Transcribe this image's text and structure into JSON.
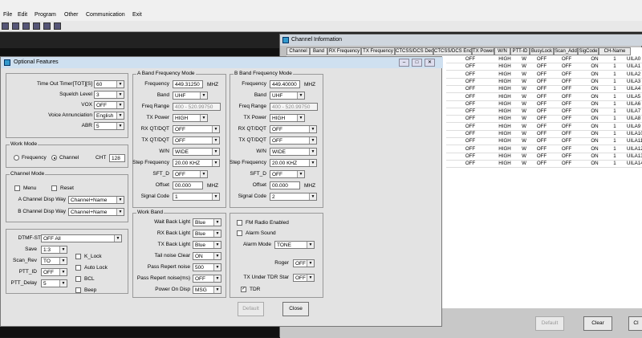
{
  "menubar": {
    "file": "File",
    "edit": "Edit",
    "program": "Program",
    "other": "Other",
    "communication": "Communication",
    "exit": "Exit"
  },
  "channel_window": {
    "title": "Channel Information",
    "headers": [
      "Channel",
      "Band",
      "RX Frequency",
      "TX Frequency",
      "CTCSS/DCS Dec",
      "CTCSS/DCS Enc",
      "TX Power",
      "W/N",
      "PTT-ID",
      "BusyLock",
      "Scan_Add",
      "SigCode",
      "CH-Name"
    ],
    "rows": [
      [
        "OFF",
        "HIGH",
        "W",
        "OFF",
        "OFF",
        "ON",
        "1",
        "UILA0"
      ],
      [
        "OFF",
        "HIGH",
        "W",
        "OFF",
        "OFF",
        "ON",
        "1",
        "UILA1"
      ],
      [
        "OFF",
        "HIGH",
        "W",
        "OFF",
        "OFF",
        "ON",
        "1",
        "UILA2"
      ],
      [
        "OFF",
        "HIGH",
        "W",
        "OFF",
        "OFF",
        "ON",
        "1",
        "UILA3"
      ],
      [
        "OFF",
        "HIGH",
        "W",
        "OFF",
        "OFF",
        "ON",
        "1",
        "UILA4"
      ],
      [
        "OFF",
        "HIGH",
        "W",
        "OFF",
        "OFF",
        "ON",
        "1",
        "UILA5"
      ],
      [
        "OFF",
        "HIGH",
        "W",
        "OFF",
        "OFF",
        "ON",
        "1",
        "UILA6"
      ],
      [
        "OFF",
        "HIGH",
        "W",
        "OFF",
        "OFF",
        "ON",
        "1",
        "UILA7"
      ],
      [
        "OFF",
        "HIGH",
        "W",
        "OFF",
        "OFF",
        "ON",
        "1",
        "UILA8"
      ],
      [
        "OFF",
        "HIGH",
        "W",
        "OFF",
        "OFF",
        "ON",
        "1",
        "UILA9"
      ],
      [
        "OFF",
        "HIGH",
        "W",
        "OFF",
        "OFF",
        "ON",
        "1",
        "UILA10"
      ],
      [
        "OFF",
        "HIGH",
        "W",
        "OFF",
        "OFF",
        "ON",
        "1",
        "UILA11"
      ],
      [
        "OFF",
        "HIGH",
        "W",
        "OFF",
        "OFF",
        "ON",
        "1",
        "UILA12"
      ],
      [
        "OFF",
        "HIGH",
        "W",
        "OFF",
        "OFF",
        "ON",
        "1",
        "UILA13"
      ],
      [
        "OFF",
        "HIGH",
        "W",
        "OFF",
        "OFF",
        "ON",
        "1",
        "UILA14"
      ]
    ],
    "default_label": "Default",
    "clear_label": "Clear",
    "clear2_label": "Cl"
  },
  "opt": {
    "title": "Optional Features",
    "tot_label": "Time Out Timer[TOT][S]",
    "tot": "60",
    "squelch_label": "Squelch Level",
    "squelch": "3",
    "vox_label": "VOX",
    "vox": "OFF",
    "voice_label": "Voice Annunciation",
    "voice": "English",
    "abr_label": "ABR",
    "abr": "5",
    "workmode_title": "Work Mode",
    "freq_label": "Frequency",
    "channel_label": "Channel",
    "cht_label": "CHT",
    "cht": "128",
    "chmode_title": "Channel Mode",
    "menu_label": "Menu",
    "reset_label": "Reset",
    "a_disp_label": "A Channel Disp Way",
    "a_disp": "Channel+Name",
    "b_disp_label": "B Channel Disp Way",
    "b_disp": "Channel+Name",
    "dtmf_label": "DTMF-ST",
    "dtmf": "OFF All",
    "save_label": "Save",
    "save": "1:3",
    "scanrev_label": "Scan_Rev",
    "scanrev": "TO",
    "pttid_label": "PTT_ID",
    "pttid": "OFF",
    "pttdelay_label": "PTT_Delay",
    "pttdelay": "5",
    "klock_label": "K_Lock",
    "autolock_label": "Auto Lock",
    "bcl_label": "BCL",
    "beep_label": "Beep",
    "aband": {
      "title": "A Band Frequency Mode",
      "freq_label": "Frequency",
      "freq": "449.31250",
      "mhz": "MHZ",
      "band_label": "Band",
      "band": "UHF",
      "range_label": "Freq Range",
      "range": "400 - 520.99750",
      "txp_label": "TX Power",
      "txp": "HIGH",
      "rxqt_label": "RX QT/DQT",
      "rxqt": "OFF",
      "txqt_label": "TX QT/DQT",
      "txqt": "OFF",
      "wn_label": "W/N",
      "wn": "WIDE",
      "step_label": "Step Frequency",
      "step": "20.00 KHZ",
      "sftd_label": "SFT_D",
      "sftd": "OFF",
      "offset_label": "Offset",
      "offset": "00.000",
      "offset_mhz": "MHZ",
      "sig_label": "Signal Code",
      "sig": "1"
    },
    "bband": {
      "title": "B Band Frequency Mode",
      "freq_label": "Frequency",
      "freq": "449.40000",
      "mhz": "MHZ",
      "band_label": "Band",
      "band": "UHF",
      "range_label": "Freq Range",
      "range": "400 - 520.99750",
      "txp_label": "TX Power",
      "txp": "HIGH",
      "rxqt_label": "RX QT/DQT",
      "rxqt": "OFF",
      "txqt_label": "TX QT/DQT",
      "txqt": "OFF",
      "wn_label": "W/N",
      "wn": "WIDE",
      "step_label": "Step Frequency",
      "step": "20.00 KHZ",
      "sftd_label": "SFT_D",
      "sftd": "OFF",
      "offset_label": "Offset",
      "offset": "00.000",
      "offset_mhz": "MHZ",
      "sig_label": "Signal Code",
      "sig": "2"
    },
    "workband": {
      "title": "Work Band",
      "wait_label": "Wait Back Light",
      "wait": "Blue",
      "rx_label": "RX Back Light",
      "rx": "Blue",
      "tx_label": "TX Back Light",
      "tx": "Blue",
      "tail_label": "Tail noise Clear",
      "tail": "ON",
      "prn_label": "Pass Repert noise",
      "prn": "500",
      "prnms_label": "Pass Repert noise(ms)",
      "prnms": "OFF",
      "pod_label": "Power On Disp",
      "pod": "MSG"
    },
    "fm_label": "FM Radio Enabled",
    "alarmsound_label": "Alarm Sound",
    "alarmmode_label": "Alarm Mode",
    "alarmmode": "TONE",
    "roger_label": "Roger",
    "roger": "OFF",
    "txtdr_label": "TX Under TDR Star",
    "txtdr": "OFF",
    "tdr_label": "TDR",
    "default_label": "Default",
    "close_label": "Close"
  }
}
